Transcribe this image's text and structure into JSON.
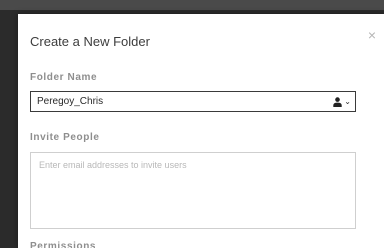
{
  "dialog": {
    "title": "Create a New Folder",
    "close_symbol": "×"
  },
  "folder_name": {
    "label": "Folder Name",
    "value": "Peregoy_Chris",
    "owner_icon": "person-icon",
    "dropdown_icon": "chevron-down-icon"
  },
  "invite_people": {
    "label": "Invite People",
    "placeholder": "Enter email addresses to invite users"
  },
  "next_section": {
    "label": "Permissions"
  },
  "colors": {
    "backdrop": "#2b2b2b",
    "dialog_bg": "#ffffff",
    "active_border": "#3a3a3a",
    "label_gray": "#8e8e8e"
  }
}
